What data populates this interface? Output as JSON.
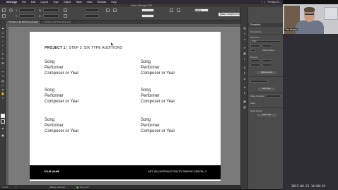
{
  "menubar": {
    "items": [
      "InDesign",
      "File",
      "Edit",
      "Layout",
      "Type",
      "Object",
      "Table",
      "View",
      "Window",
      "Help"
    ],
    "status": [
      "Fri Sep 23 ..."
    ]
  },
  "app": {
    "title": "Adobe InDesign 2022"
  },
  "control": {
    "x_label": "X:",
    "y_label": "Y:",
    "w_label": "W:",
    "h_label": "H:",
    "stroke_value": "0 pt",
    "zoom_value": "100%",
    "frame_style": "[Basic Graphics Frame]"
  },
  "typography": {
    "label": "Typography"
  },
  "tabs": [
    {
      "label": "*Untitled-1 @ 52% [Converted]",
      "active": true
    },
    {
      "label": "*Untitled-2 @ 52% [Preview]",
      "active": false
    }
  ],
  "page": {
    "heading_bold": "PROJECT 1",
    "heading_rest": " | STEP 3: SIX TYPE AUDITIONS",
    "entry_lines": [
      "Song",
      "Performer",
      "Composer or Year"
    ],
    "footer_left": "YOUR NAME",
    "footer_right": "ART 100 | INTRODUCTION TO GRAPHIC DESIGN | 3"
  },
  "status": {
    "zoom": "72.5%",
    "page": "1",
    "state": "[Basic] (working)",
    "errors": "No errors"
  },
  "properties": {
    "tab": "Properties",
    "no_selection": "No Selection",
    "section_document": "Document",
    "letter": "Letter",
    "margins_label": "Margins",
    "adjust_layout": "Adjust Layout",
    "ruler_guides": "Ruler & Guides",
    "grids": "Grids",
    "edit_page": "Edit Page",
    "quick_actions": "Quick Actions",
    "import_file": "Import File",
    "page_count": "1",
    "facing_pages": "Facing Pages"
  },
  "webcam": {
    "name": "Tim Hosen"
  },
  "timestamp": "2022-09-23 14:08:29"
}
